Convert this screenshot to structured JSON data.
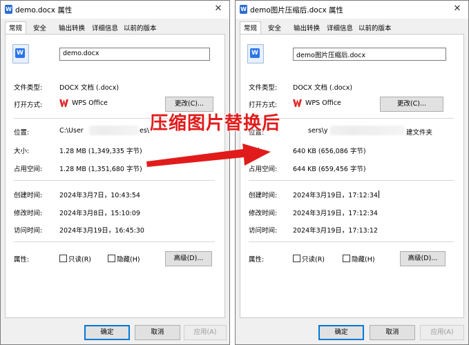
{
  "left": {
    "title": "demo.docx 属性",
    "tabs": [
      "常规",
      "安全",
      "输出转换",
      "详细信息",
      "以前的版本"
    ],
    "filename": "demo.docx",
    "file_type_label": "文件类型:",
    "file_type_value": "DOCX 文档 (.docx)",
    "open_with_label": "打开方式:",
    "open_with_value": "WPS Office",
    "change_button": "更改(C)...",
    "location_label": "位置:",
    "location_value_start": "C:\\User",
    "location_value_end": "es\\",
    "size_label": "大小:",
    "size_value": "1.28 MB (1,349,335 字节)",
    "disk_size_label": "占用空间:",
    "disk_size_value": "1.28 MB (1,351,680 字节)",
    "created_label": "创建时间:",
    "created_value": "2024年3月7日，10:43:54",
    "modified_label": "修改时间:",
    "modified_value": "2024年3月8日，15:10:09",
    "accessed_label": "访问时间:",
    "accessed_value": "2024年3月19日，16:45:30",
    "attributes_label": "属性:",
    "readonly_label": "只读(R)",
    "hidden_label": "隐藏(H)",
    "advanced_button": "高级(D)...",
    "ok_button": "确定",
    "cancel_button": "取消",
    "apply_button": "应用(A)"
  },
  "right": {
    "title": "demo图片压缩后.docx 属性",
    "tabs": [
      "常规",
      "安全",
      "输出转换",
      "详细信息",
      "以前的版本"
    ],
    "filename": "demo图片压缩后.docx",
    "file_type_label": "文件类型:",
    "file_type_value": "DOCX 文档 (.docx)",
    "open_with_label": "打开方式:",
    "open_with_value": "WPS Office",
    "change_button": "更改(C)...",
    "location_label": "位置:",
    "location_value_start": "sers\\y",
    "location_value_end": "建文件夹",
    "size_label": "大小:",
    "size_value": "640 KB (656,086 字节)",
    "disk_size_label": "占用空间:",
    "disk_size_value": "644 KB (659,456 字节)",
    "created_label": "创建时间:",
    "created_value": "2024年3月19日，17:12:34",
    "modified_label": "修改时间:",
    "modified_value": "2024年3月19日，17:12:34",
    "accessed_label": "访问时间:",
    "accessed_value": "2024年3月19日，17:13:12",
    "attributes_label": "属性:",
    "readonly_label": "只读(R)",
    "hidden_label": "隐藏(H)",
    "advanced_button": "高级(D)...",
    "ok_button": "确定",
    "cancel_button": "取消",
    "apply_button": "应用(A)"
  },
  "annotation": {
    "banner_text": "压缩图片替换后",
    "color": "#e11b1b"
  },
  "icons": {
    "app_icon": "word-doc-icon",
    "close_icon": "close-icon",
    "wps_icon": "wps-logo-icon"
  }
}
